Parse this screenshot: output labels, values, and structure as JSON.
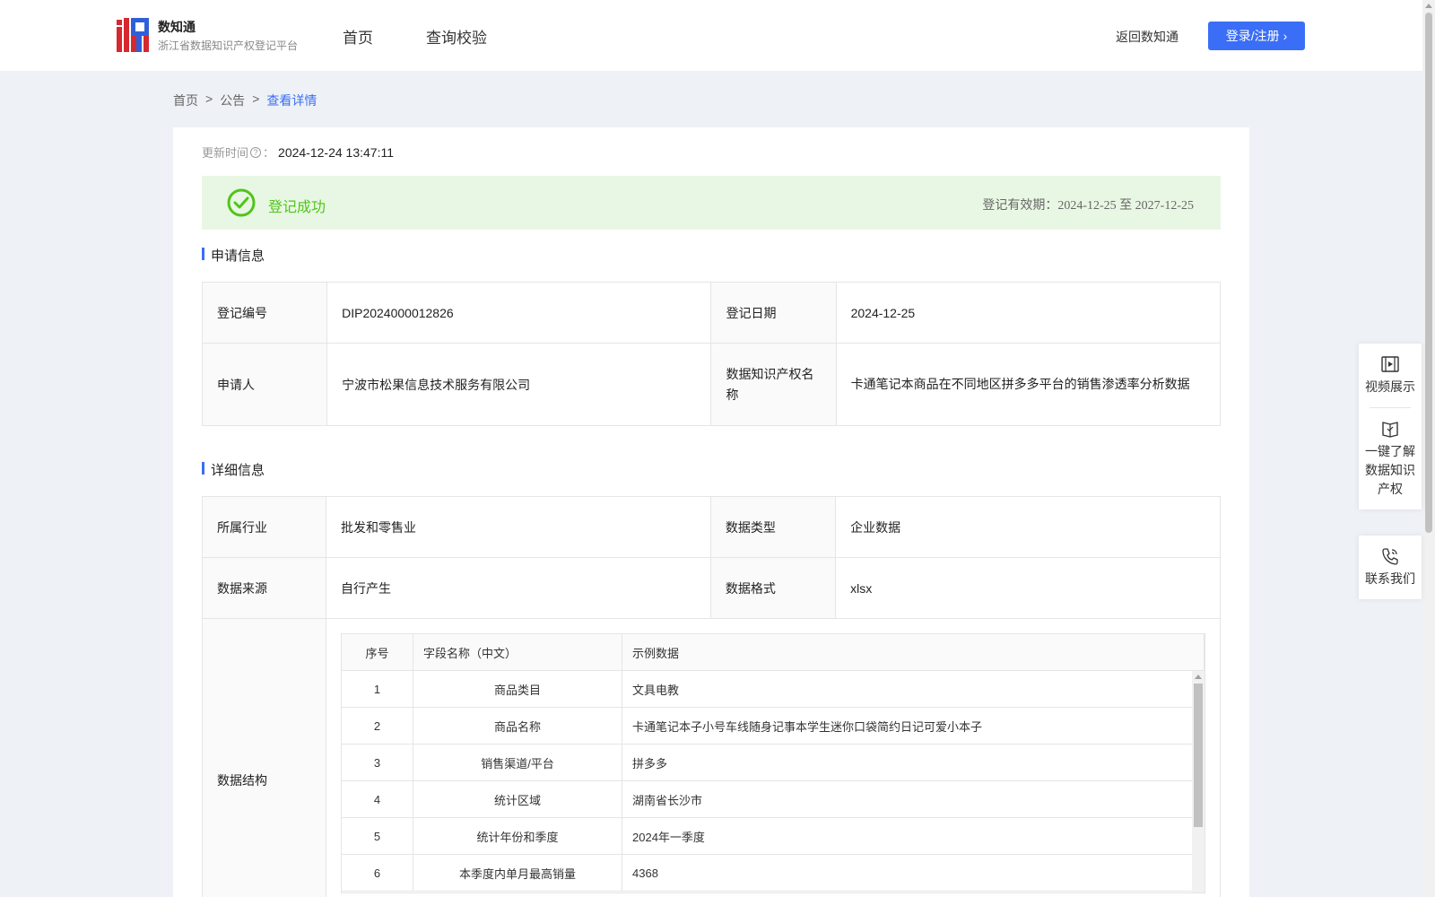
{
  "header": {
    "brand_name": "数知通",
    "brand_sub": "浙江省数据知识产权登记平台",
    "nav": [
      "首页",
      "查询校验"
    ],
    "back_link": "返回数知通",
    "login_label": "登录/注册"
  },
  "breadcrumb": {
    "items": [
      "首页",
      "公告"
    ],
    "separator": ">",
    "current": "查看详情"
  },
  "update": {
    "label": "更新时间",
    "colon": "：",
    "value": "2024-12-24 13:47:11"
  },
  "status": {
    "text": "登记成功",
    "validity_label": "登记有效期：",
    "validity_dates": "2024-12-25 至 2027-12-25",
    "color": "#52c41a"
  },
  "sections": {
    "apply": "申请信息",
    "detail": "详细信息"
  },
  "apply_info": {
    "reg_no_label": "登记编号",
    "reg_no": "DIP2024000012826",
    "reg_date_label": "登记日期",
    "reg_date": "2024-12-25",
    "applicant_label": "申请人",
    "applicant": "宁波市松果信息技术服务有限公司",
    "ip_name_label": "数据知识产权名称",
    "ip_name": "卡通笔记本商品在不同地区拼多多平台的销售渗透率分析数据"
  },
  "detail_info": {
    "industry_label": "所属行业",
    "industry": "批发和零售业",
    "data_type_label": "数据类型",
    "data_type": "企业数据",
    "source_label": "数据来源",
    "source": "自行产生",
    "format_label": "数据格式",
    "format": "xlsx",
    "structure_label": "数据结构"
  },
  "structure_table": {
    "headers": [
      "序号",
      "字段名称（中文）",
      "示例数据"
    ],
    "rows": [
      [
        "1",
        "商品类目",
        "文具电教"
      ],
      [
        "2",
        "商品名称",
        "卡通笔记本子小号车线随身记事本学生迷你口袋简约日记可爱小本子"
      ],
      [
        "3",
        "销售渠道/平台",
        "拼多多"
      ],
      [
        "4",
        "统计区域",
        "湖南省长沙市"
      ],
      [
        "5",
        "统计年份和季度",
        "2024年一季度"
      ],
      [
        "6",
        "本季度内单月最高销量",
        "4368"
      ]
    ]
  },
  "side_panel": {
    "video": "视频展示",
    "learn": "一键了解数据知识产权",
    "contact": "联系我们"
  },
  "colors": {
    "accent": "#3b6ef6",
    "success_bg": "#e8f7e3",
    "logo_red": "#d6282f",
    "logo_blue": "#2f5fd8"
  }
}
